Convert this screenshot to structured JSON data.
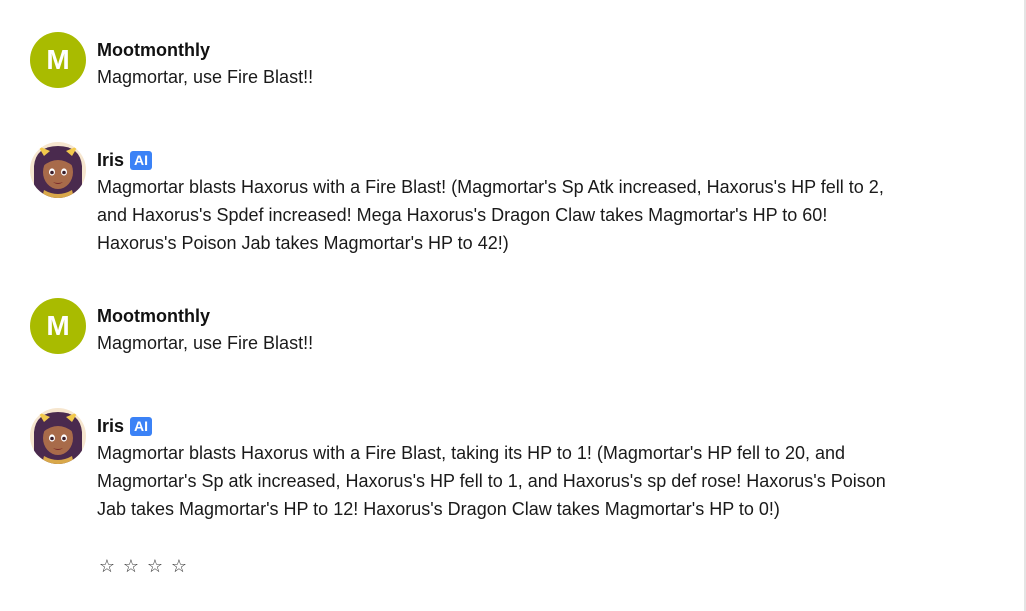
{
  "messages": [
    {
      "author": "Mootmonthly",
      "avatar_letter": "M",
      "text": "Magmortar, use Fire Blast!!"
    },
    {
      "author": "Iris",
      "badge": "AI",
      "text": "Magmortar blasts Haxorus with a Fire Blast! (Magmortar's Sp Atk increased, Haxorus's HP fell to 2, and Haxorus's Spdef increased! Mega Haxorus's Dragon Claw takes Magmortar's HP to 60! Haxorus's Poison Jab takes Magmortar's HP to 42!)"
    },
    {
      "author": "Mootmonthly",
      "avatar_letter": "M",
      "text": "Magmortar, use Fire Blast!!"
    },
    {
      "author": "Iris",
      "badge": "AI",
      "text": "Magmortar blasts Haxorus with a Fire Blast, taking its HP to 1! (Magmortar's HP fell to 20, and Magmortar's Sp atk increased, Haxorus's HP fell to 1, and Haxorus's sp def rose! Haxorus's Poison Jab takes Magmortar's HP to 12! Haxorus's Dragon Claw takes Magmortar's HP to 0!)"
    }
  ],
  "rating": {
    "stars": [
      "☆",
      "☆",
      "☆",
      "☆"
    ]
  },
  "colors": {
    "user_avatar": "#a9bb00",
    "ai_badge": "#3b82f6"
  }
}
